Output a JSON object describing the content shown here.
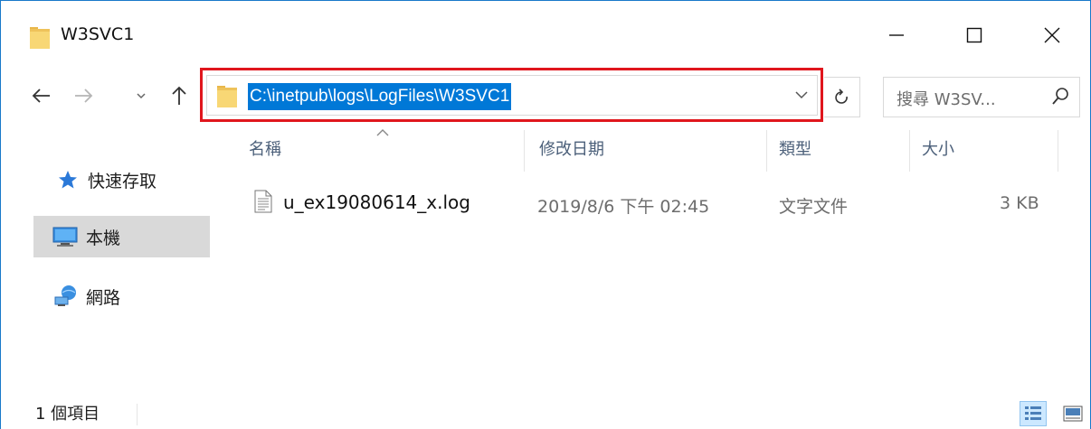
{
  "window": {
    "title": "W3SVC1"
  },
  "address_bar": {
    "path": "C:\\inetpub\\logs\\LogFiles\\W3SVC1"
  },
  "search": {
    "placeholder": "搜尋 W3SV..."
  },
  "nav_pane": {
    "items": [
      {
        "label": "快速存取",
        "icon": "star-icon"
      },
      {
        "label": "本機",
        "icon": "computer-icon",
        "selected": true
      },
      {
        "label": "網路",
        "icon": "network-icon"
      }
    ]
  },
  "columns": [
    "名稱",
    "修改日期",
    "類型",
    "大小"
  ],
  "files": [
    {
      "name": "u_ex19080614_x.log",
      "modified": "2019/8/6 下午 02:45",
      "type": "文字文件",
      "size": "3 KB"
    }
  ],
  "status": {
    "item_count": "1 個項目"
  },
  "colors": {
    "accent": "#0078d7",
    "highlight_border": "#e0161d",
    "selected_nav": "#d9d9d9"
  }
}
